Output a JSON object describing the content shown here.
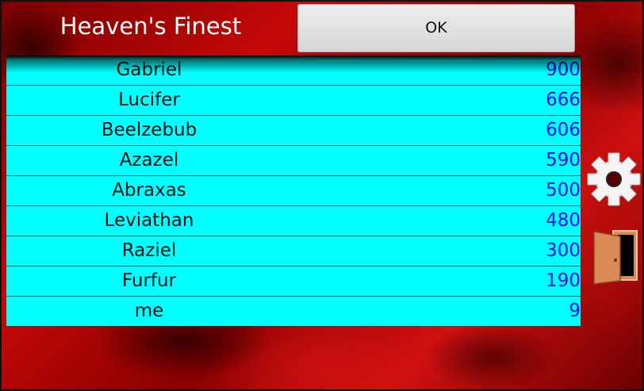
{
  "header": {
    "title": "Heaven's Finest",
    "ok_label": "OK"
  },
  "leaderboard": {
    "rows": [
      {
        "name": "Gabriel",
        "score": "900"
      },
      {
        "name": "Lucifer",
        "score": "666"
      },
      {
        "name": "Beelzebub",
        "score": "606"
      },
      {
        "name": "Azazel",
        "score": "590"
      },
      {
        "name": "Abraxas",
        "score": "500"
      },
      {
        "name": "Leviathan",
        "score": "480"
      },
      {
        "name": "Raziel",
        "score": "300"
      },
      {
        "name": "Furfur",
        "score": "190"
      },
      {
        "name": "me",
        "score": "9"
      }
    ]
  },
  "side_buttons": {
    "settings_icon": "gear-icon",
    "exit_icon": "open-door-icon"
  },
  "colors": {
    "list_background": "#00ffff",
    "score_text": "#1111ee",
    "name_text": "#111111",
    "title_text": "#ffffff",
    "background_red": "#c40808"
  }
}
